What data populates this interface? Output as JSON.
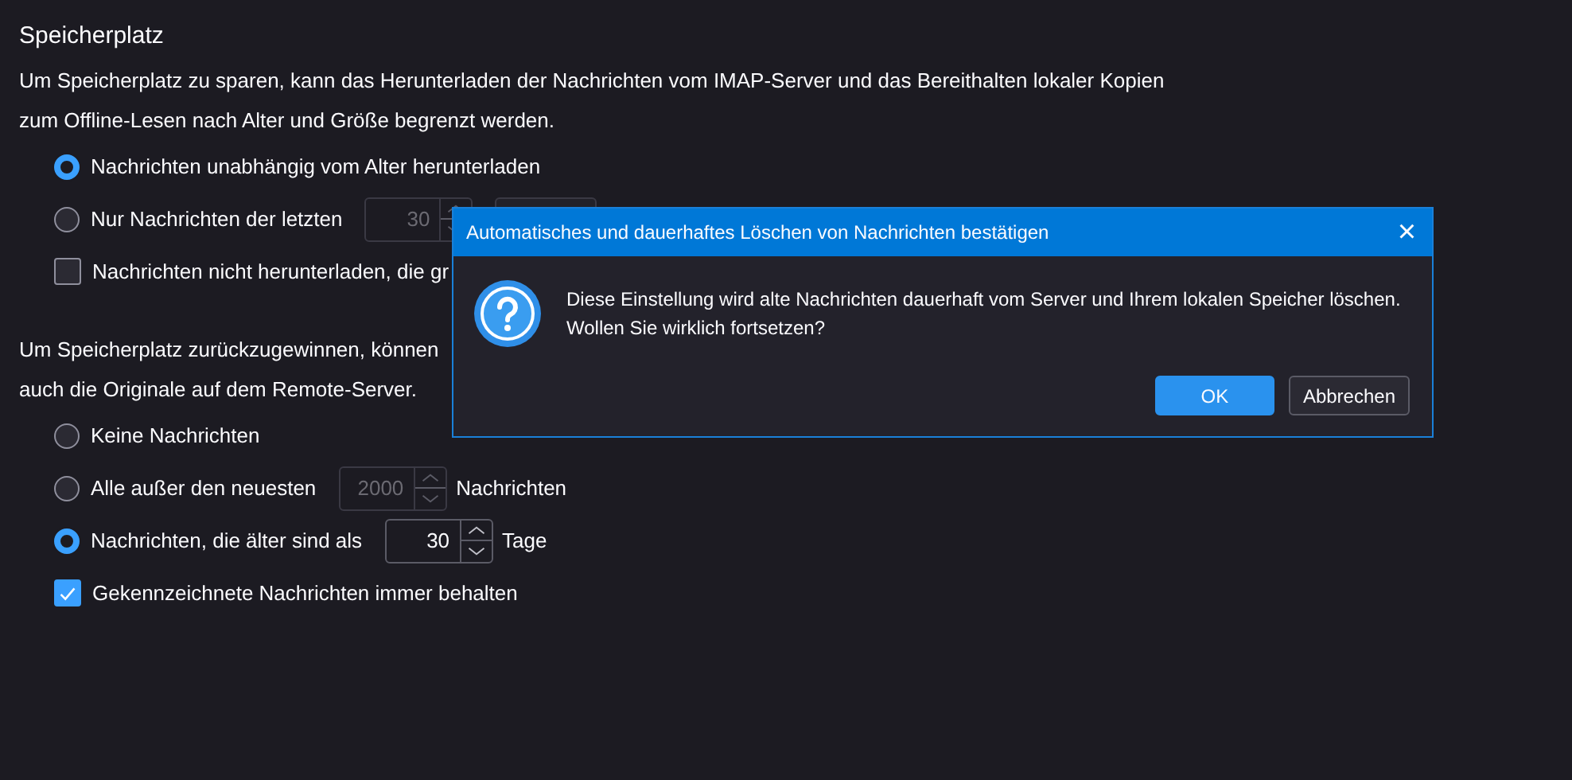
{
  "heading": "Speicherplatz",
  "sections": [
    {
      "description_lines": [
        "Um Speicherplatz zu sparen, kann das Herunterladen der Nachrichten vom IMAP-Server und das Bereithalten lokaler Kopien",
        "zum Offline-Lesen nach Alter und Größe begrenzt werden."
      ],
      "options": [
        {
          "kind": "radio",
          "label": "Nachrichten unabhängig vom Alter herunterladen",
          "selected": true
        },
        {
          "kind": "radio",
          "label": "Nur Nachrichten der letzten",
          "selected": false,
          "spinner": {
            "value": "30",
            "disabled": true
          },
          "unit_dropdown": {
            "disabled": true
          }
        },
        {
          "kind": "checkbox",
          "label": "Nachrichten nicht herunterladen, die gr",
          "checked": false
        }
      ]
    },
    {
      "description_lines": [
        "Um Speicherplatz zurückzugewinnen, können",
        "auch die Originale auf dem Remote-Server."
      ],
      "options": [
        {
          "kind": "radio",
          "label": "Keine Nachrichten",
          "selected": false
        },
        {
          "kind": "radio",
          "label": "Alle außer den neuesten",
          "selected": false,
          "spinner": {
            "value": "2000",
            "disabled": true
          },
          "unit": "Nachrichten"
        },
        {
          "kind": "radio",
          "label": "Nachrichten, die älter sind als",
          "selected": true,
          "spinner": {
            "value": "30",
            "disabled": false
          },
          "unit": "Tage"
        },
        {
          "kind": "checkbox",
          "label": "Gekennzeichnete Nachrichten immer behalten",
          "checked": true
        }
      ]
    }
  ],
  "dialog": {
    "title": "Automatisches und dauerhaftes Löschen von Nachrichten bestätigen",
    "close": "×",
    "message_lines": [
      "Diese Einstellung wird alte Nachrichten dauerhaft vom Server und Ihrem lokalen Speicher löschen.",
      "Wollen Sie wirklich fortsetzen?"
    ],
    "buttons": [
      {
        "label": "OK",
        "primary": true
      },
      {
        "label": "Abbrechen",
        "primary": false
      }
    ]
  }
}
